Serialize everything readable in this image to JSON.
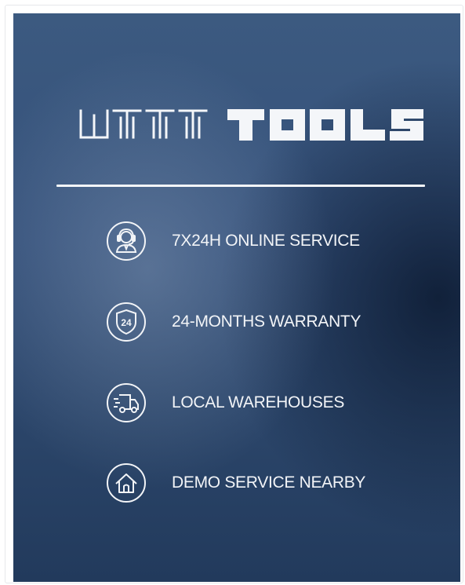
{
  "brand": {
    "logo_text": "WTTTOOLS"
  },
  "features": [
    {
      "icon": "headset-agent-icon",
      "label": "7X24H ONLINE SERVICE"
    },
    {
      "icon": "warranty-24-shield-icon",
      "label": "24-MONTHS WARRANTY"
    },
    {
      "icon": "delivery-truck-icon",
      "label": "LOCAL WAREHOUSES"
    },
    {
      "icon": "home-icon",
      "label": "DEMO SERVICE NEARBY"
    }
  ],
  "colors": {
    "background_top": "#3c5a80",
    "background_bottom": "#223a5c",
    "text": "#f2f4f7"
  }
}
